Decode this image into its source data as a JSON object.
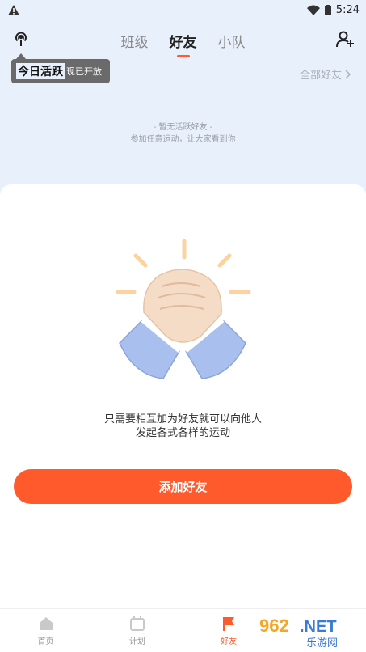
{
  "status": {
    "time": "5:24",
    "alert_icon": "warning-icon",
    "wifi_icon": "wifi-icon",
    "battery_icon": "battery-icon"
  },
  "header": {
    "tabs": [
      {
        "label": "班级",
        "active": false
      },
      {
        "label": "好友",
        "active": true
      },
      {
        "label": "小队",
        "active": false
      }
    ],
    "left_icon": "podcast-icon",
    "right_icon": "add-friend-icon"
  },
  "tooltip": {
    "title": "今日活跃",
    "text": "现已开放"
  },
  "all_friends": {
    "label": "全部好友"
  },
  "empty_state": {
    "line1": "-    暂无活跃好友 -",
    "line2": "参加任意运动，让大家看到你"
  },
  "card": {
    "desc_line1": "只需要相互加为好友就可以向他人",
    "desc_line2": "发起各式各样的运动",
    "button": "添加好友"
  },
  "bottom_nav": [
    {
      "label": "首页",
      "icon": "home-icon",
      "active": false
    },
    {
      "label": "计划",
      "icon": "calendar-icon",
      "active": false
    },
    {
      "label": "好友",
      "icon": "flag-icon",
      "active": true
    },
    {
      "label": "",
      "icon": "",
      "active": false
    }
  ],
  "watermark": {
    "text": "962.NET",
    "subtext": "乐游网"
  },
  "colors": {
    "accent": "#ff5a2c",
    "bg_top": "#e8f0fb"
  }
}
